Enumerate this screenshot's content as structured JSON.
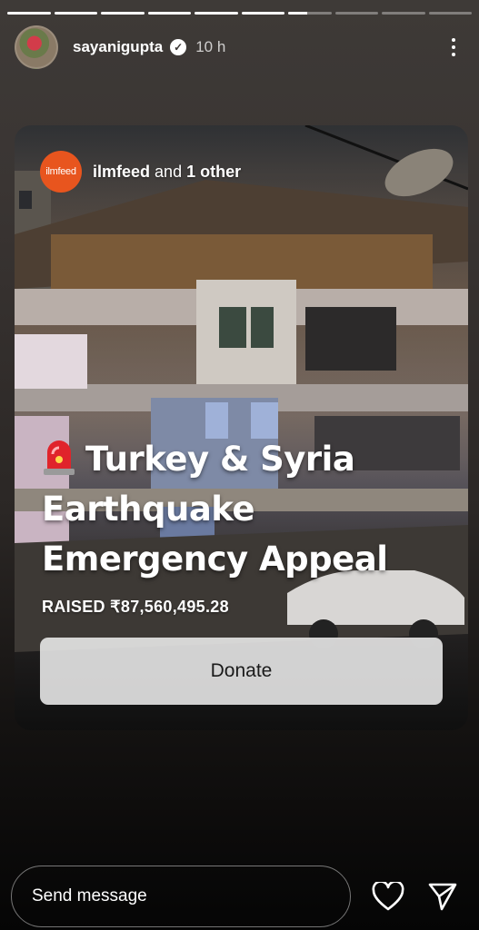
{
  "story": {
    "progress_segments": 10,
    "progress_current_fill": 0.45,
    "progress_completed": 6
  },
  "header": {
    "username": "sayanigupta",
    "verified_glyph": "✓",
    "time": "10 h",
    "icons": {
      "avatar": "profile-avatar",
      "verified": "verified-badge-icon",
      "more": "more-options-icon"
    }
  },
  "post": {
    "credit_logo_text": "ilmfeed",
    "credit_name": "ilmfeed",
    "credit_and": "and",
    "credit_others": "1 other",
    "headline": "Turkey & Syria Earthquake Emergency Appeal",
    "headline_icon": "siren-icon",
    "raised_label": "RAISED",
    "raised_amount": "₹87,560,495.28",
    "donate_label": "Donate"
  },
  "footer": {
    "message_placeholder": "Send message",
    "icons": [
      "heart-icon",
      "send-icon"
    ]
  },
  "colors": {
    "brand_orange": "#e8551e",
    "button_bg": "#ececec",
    "siren_red": "#e0242b"
  }
}
